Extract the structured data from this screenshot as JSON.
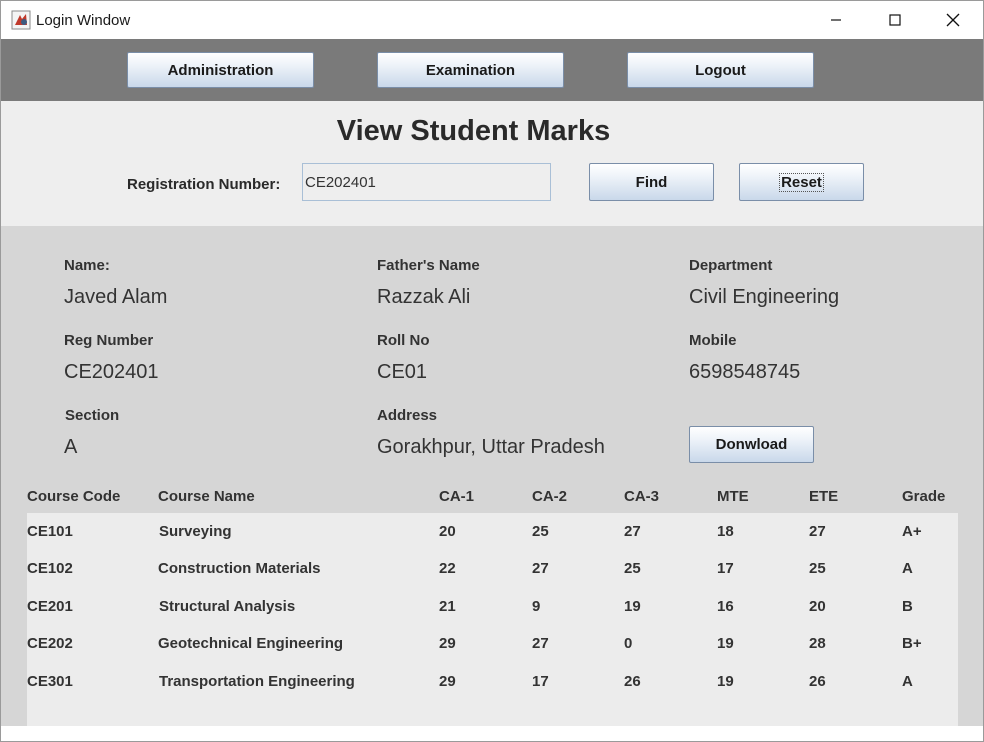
{
  "window": {
    "title": "Login Window"
  },
  "menu": {
    "administration": "Administration",
    "examination": "Examination",
    "logout": "Logout"
  },
  "header": {
    "title": "View Student Marks",
    "reg_label": "Registration Number:",
    "reg_value": "CE202401",
    "find_label": "Find",
    "reset_label": "Reset"
  },
  "student": {
    "name_label": "Name:",
    "name": "Javed Alam",
    "father_label": "Father's Name",
    "father": "Razzak Ali",
    "dept_label": "Department",
    "dept": "Civil Engineering",
    "reg_label": "Reg Number",
    "reg": "CE202401",
    "roll_label": "Roll No",
    "roll": "CE01",
    "mobile_label": "Mobile",
    "mobile": "6598548745",
    "section_label": "Section",
    "section": "A",
    "address_label": "Address",
    "address": "Gorakhpur, Uttar Pradesh",
    "download_label": "Donwload"
  },
  "table": {
    "columns": [
      "Course Code",
      "Course Name",
      "CA-1",
      "CA-2",
      "CA-3",
      "MTE",
      "ETE",
      "Grade"
    ],
    "rows": [
      [
        "CE101",
        "Surveying",
        "20",
        "25",
        "27",
        "18",
        "27",
        "A+"
      ],
      [
        "CE102",
        "Construction Materials",
        "22",
        "27",
        "25",
        "17",
        "25",
        "A"
      ],
      [
        "CE201",
        "Structural Analysis",
        "21",
        "9",
        "19",
        "16",
        "20",
        "B"
      ],
      [
        "CE202",
        "Geotechnical Engineering",
        "29",
        "27",
        "0",
        "19",
        "28",
        "B+"
      ],
      [
        "CE301",
        "Transportation Engineering",
        "29",
        "17",
        "26",
        "19",
        "26",
        "A"
      ]
    ]
  },
  "colors": {
    "menubar": "#7a7a7a",
    "header_bg": "#eeeeee",
    "details_bg": "#d6d6d6",
    "table_bg": "#ececec"
  }
}
